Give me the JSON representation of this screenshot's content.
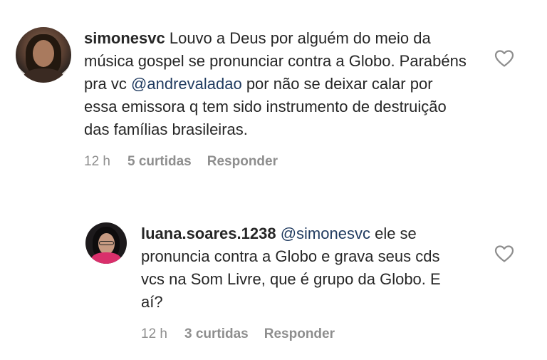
{
  "comments": [
    {
      "username": "simonesvc",
      "text_before": " Louvo a Deus por alguém do meio da música gospel se pronunciar contra a Globo. Parabéns pra vc ",
      "mention": "@andrevaladao",
      "text_after": " por não se deixar calar por essa emissora q tem sido instrumento de destruição das famílias brasileiras.",
      "time": "12 h",
      "likes": "5 curtidas",
      "reply_label": "Responder",
      "like_icon": "heart-outline-icon"
    },
    {
      "username": "luana.soares.1238",
      "mention": "@simonesvc",
      "text_after": " ele se pronuncia contra a Globo e grava seus cds vcs na Som Livre, que é  grupo da Globo. E aí?",
      "time": "12 h",
      "likes": "3 curtidas",
      "reply_label": "Responder",
      "like_icon": "heart-outline-icon"
    }
  ],
  "colors": {
    "text": "#262626",
    "meta": "#8e8e8e",
    "mention": "#1f3a5f"
  }
}
